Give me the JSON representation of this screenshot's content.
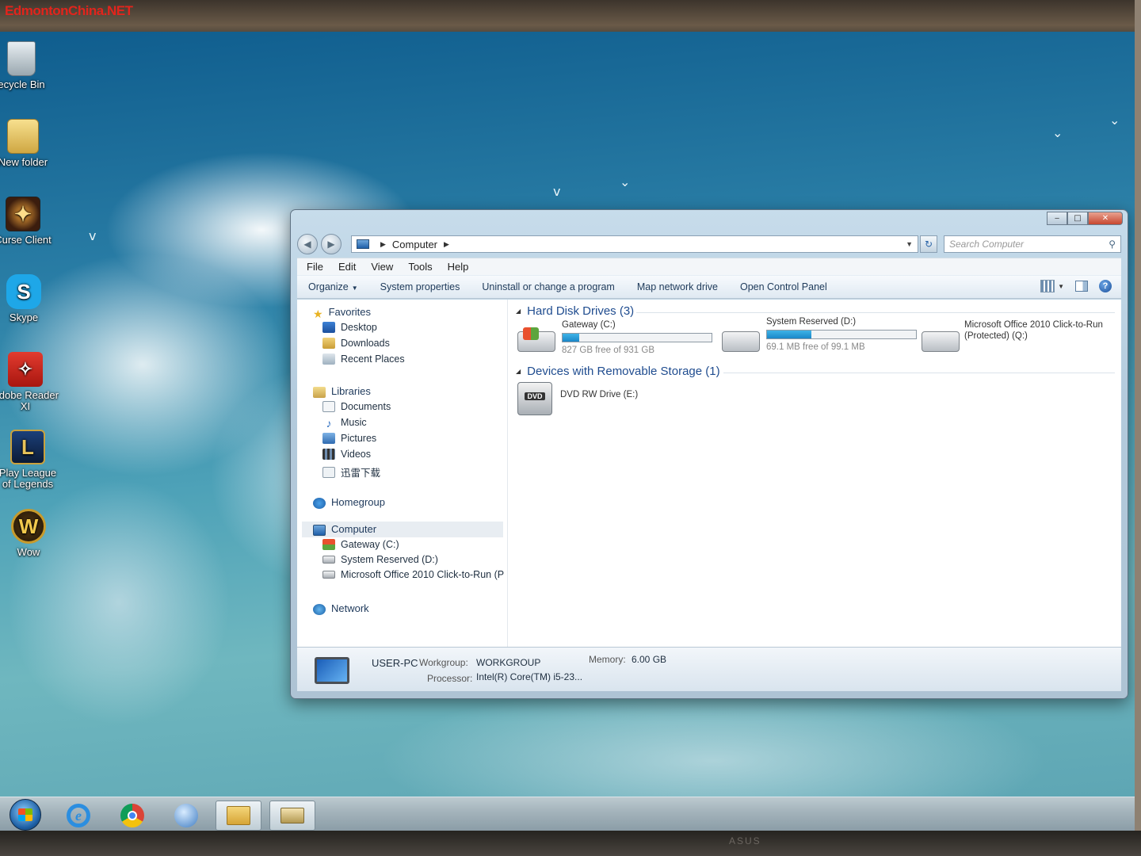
{
  "watermark": "EdmontonChina.NET",
  "bezel_brand": "ASUS",
  "desktop": {
    "icons": [
      {
        "id": "recycle-bin",
        "label": "ecycle Bin",
        "icon": "recycle-bin-icon"
      },
      {
        "id": "new-folder",
        "label": "New folder",
        "icon": "folder-icon"
      },
      {
        "id": "curse-client",
        "label": "Curse Client",
        "icon": "curse-client-icon"
      },
      {
        "id": "skype",
        "label": "Skype",
        "icon": "skype-icon"
      },
      {
        "id": "adobe-reader",
        "label": "Adobe Reader XI",
        "icon": "adobe-reader-icon"
      },
      {
        "id": "league",
        "label": "Play League of Legends",
        "icon": "league-of-legends-icon"
      },
      {
        "id": "wow",
        "label": "Wow",
        "icon": "world-of-warcraft-icon"
      }
    ]
  },
  "window": {
    "controls": {
      "minimize": "‒",
      "maximize": "□",
      "close": "✕"
    },
    "address": {
      "root": "Computer"
    },
    "search": {
      "placeholder": "Search Computer"
    },
    "menu": [
      "File",
      "Edit",
      "View",
      "Tools",
      "Help"
    ],
    "commands": [
      "Organize",
      "System properties",
      "Uninstall or change a program",
      "Map network drive",
      "Open Control Panel"
    ],
    "nav": {
      "favorites": {
        "label": "Favorites",
        "items": [
          "Desktop",
          "Downloads",
          "Recent Places"
        ]
      },
      "libraries": {
        "label": "Libraries",
        "items": [
          "Documents",
          "Music",
          "Pictures",
          "Videos",
          "迅雷下载"
        ]
      },
      "homegroup": "Homegroup",
      "computer": {
        "label": "Computer",
        "items": [
          "Gateway (C:)",
          "System Reserved (D:)",
          "Microsoft Office 2010 Click-to-Run (P"
        ]
      },
      "network": "Network"
    },
    "hard_disk_section": "Hard Disk Drives (3)",
    "removable_section": "Devices with Removable Storage (1)",
    "drives": [
      {
        "name": "Gateway (C:)",
        "free_text": "827 GB free of 931 GB",
        "used_fraction": 0.11
      },
      {
        "name": "System Reserved (D:)",
        "free_text": "69.1 MB free of 99.1 MB",
        "used_fraction": 0.3
      },
      {
        "name": "Microsoft Office 2010 Click-to-Run",
        "line2": "(Protected) (Q:)"
      }
    ],
    "dvd": {
      "name": "DVD RW Drive (E:)",
      "badge": "DVD"
    },
    "details": {
      "computer_name": "USER-PC",
      "workgroup_label": "Workgroup:",
      "workgroup": "WORKGROUP",
      "memory_label": "Memory:",
      "memory": "6.00 GB",
      "processor_label": "Processor:",
      "processor": "Intel(R) Core(TM) i5-23..."
    }
  },
  "taskbar": {
    "items": [
      "start-button",
      "internet-explorer",
      "chrome",
      "media-player",
      "windows-explorer",
      "drive-app"
    ]
  }
}
